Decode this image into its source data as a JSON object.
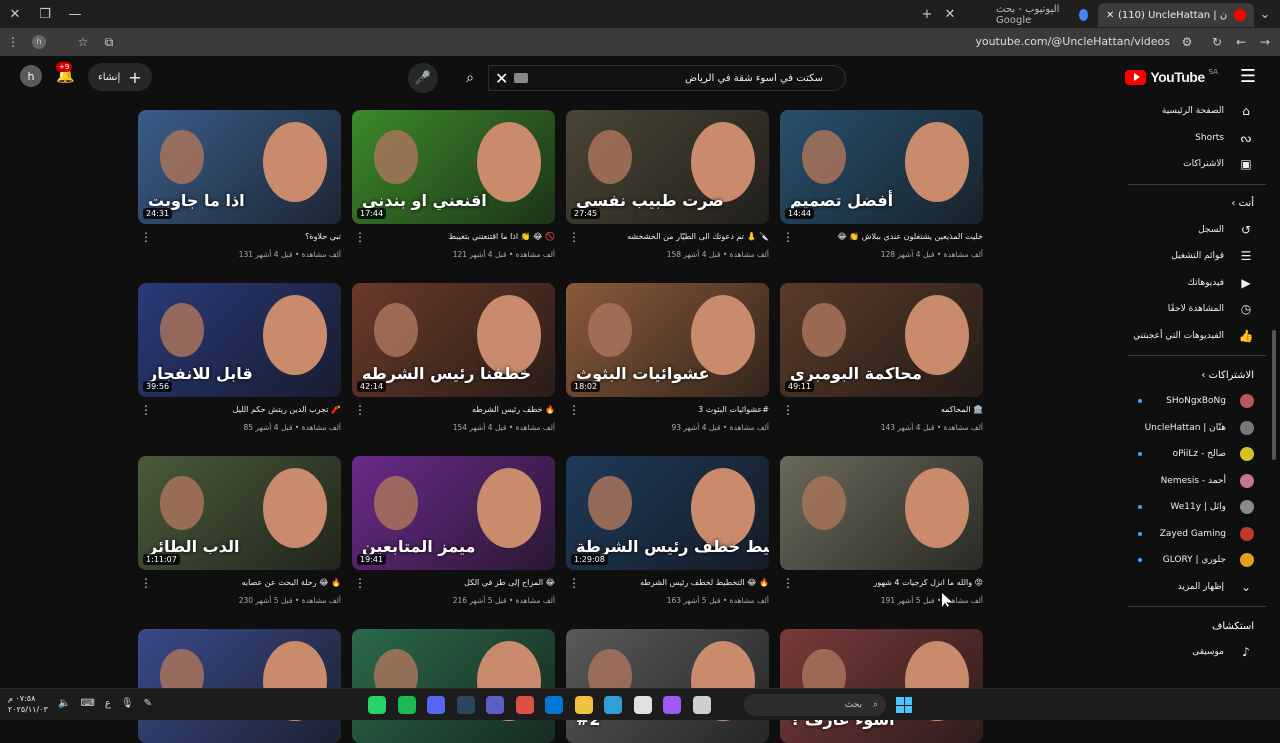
{
  "browser": {
    "tabs": [
      {
        "label": "(110) UncleHattan | هتّان - YouT",
        "active": true
      },
      {
        "label": "اليوتيوب - بحث Google",
        "active": false
      }
    ],
    "url": "youtube.com/@UncleHattan/videos"
  },
  "yt": {
    "logo_text": "YouTube",
    "region": "SA",
    "search_query": "سكتت في اسوء شقة في الرياض",
    "create_label": "إنشاء",
    "notif_count": "+9",
    "avatar_letter": "h"
  },
  "sidebar": {
    "main": [
      {
        "label": "الصفحة الرئيسية",
        "icon": "home-icon",
        "glyph": "⌂"
      },
      {
        "label": "Shorts",
        "icon": "shorts-icon",
        "glyph": "ᔓ"
      },
      {
        "label": "الاشتراكات",
        "icon": "subscriptions-icon",
        "glyph": "▣"
      }
    ],
    "you_header": "أنت",
    "you": [
      {
        "label": "السجل",
        "icon": "history-icon",
        "glyph": "↺"
      },
      {
        "label": "قوائم التشغيل",
        "icon": "playlists-icon",
        "glyph": "☰"
      },
      {
        "label": "فيديوهاتك",
        "icon": "your-videos-icon",
        "glyph": "▶"
      },
      {
        "label": "المشاهدة لاحقًا",
        "icon": "watch-later-icon",
        "glyph": "◷"
      },
      {
        "label": "الفيديوهات التي أعجبتني",
        "icon": "liked-icon",
        "glyph": "👍"
      }
    ],
    "subs_header": "الاشتراكات",
    "subs": [
      {
        "label": "SHoNgxBoNg",
        "color": "#b45a5a",
        "dot": true
      },
      {
        "label": "UncleHattan | هتّان",
        "color": "#777777",
        "dot": false
      },
      {
        "label": "oPiiLz - صالح",
        "color": "#d4c21f",
        "dot": true
      },
      {
        "label": "Nemesis - أحمد",
        "color": "#c0789a",
        "dot": false
      },
      {
        "label": "We11y | وائل",
        "color": "#8a8a8a",
        "dot": true
      },
      {
        "label": "Zayed Gaming",
        "color": "#c0392b",
        "dot": true
      },
      {
        "label": "GLORY | جلوري",
        "color": "#e0a21a",
        "dot": true
      }
    ],
    "show_more": "إظهار المزيد",
    "explore_header": "استكشاف",
    "explore": [
      {
        "label": "موسيقى",
        "icon": "music-icon",
        "glyph": "♪"
      }
    ]
  },
  "videos": [
    {
      "title": "😂 👏 خليت المذيعين يشتغلون عندي ببلاش",
      "views": "128 ألف مشاهدة",
      "age": "قبل 4 أشهر",
      "duration": "14:44",
      "caption": "أفضل تصميم",
      "bg": "#27506d"
    },
    {
      "title": "تم دعوتك الى الطيّار من الخشخشه 👃 🔪",
      "views": "158 ألف مشاهدة",
      "age": "قبل 4 أشهر",
      "duration": "27:45",
      "caption": "صرت طبيب نفسي",
      "bg": "#4a4535"
    },
    {
      "title": "اذا ما اقتنعتني بتغيبط 👏 😂 🚫",
      "views": "121 ألف مشاهدة",
      "age": "قبل 4 أشهر",
      "duration": "17:44",
      "caption": "اقنعني او بندني",
      "bg": "#3c8a2a"
    },
    {
      "title": "تبي حلاوة؟",
      "views": "131 ألف مشاهدة",
      "age": "قبل 4 أشهر",
      "duration": "24:31",
      "caption": "اذا ما جاوبت",
      "bg": "#3a5d8a"
    },
    {
      "title": "المحاكمه 🏛️",
      "views": "143 ألف مشاهدة",
      "age": "قبل 4 أشهر",
      "duration": "49:11",
      "caption": "محاكمة البومبري",
      "bg": "#5a3a2a"
    },
    {
      "title": "عشوائيات البثوث 3#",
      "views": "93 ألف مشاهدة",
      "age": "قبل 4 أشهر",
      "duration": "18:02",
      "caption": "عشوائيات البثوث",
      "bg": "#8a5a3a"
    },
    {
      "title": "خطف رئيس الشرطه 🔥",
      "views": "154 ألف مشاهدة",
      "age": "قبل 4 أشهر",
      "duration": "42:14",
      "caption": "خطفنا رئيس الشرطه",
      "bg": "#6a3a2a"
    },
    {
      "title": "تجرب الدين ريتش حكم الليل 🧨",
      "views": "85 ألف مشاهدة",
      "age": "قبل 4 أشهر",
      "duration": "39:56",
      "caption": "قابل للانفجار",
      "bg": "#2a3a7a"
    },
    {
      "title": "والله ما انزل كرجيات 4 شهور 😡",
      "views": "191 ألف مشاهدة",
      "age": "قبل 5 أشهر",
      "duration": "",
      "caption": "",
      "bg": "#6a6a5a"
    },
    {
      "title": "التخطيط لخطف رئيس الشرطه 😂 🔥",
      "views": "163 ألف مشاهدة",
      "age": "قبل 5 أشهر",
      "duration": "1:29:08",
      "caption": "تخطيط خطف رئيس الشرطة",
      "bg": "#1f3a5a"
    },
    {
      "title": "المزاح إلى طز في الكل 😂",
      "views": "216 ألف مشاهدة",
      "age": "قبل 5 أشهر",
      "duration": "19:41",
      "caption": "ميمز المتابعين",
      "bg": "#6a2a8a"
    },
    {
      "title": "رحلة البحث عن عصابه 😂 🔥",
      "views": "230 ألف مشاهدة",
      "age": "قبل 5 أشهر",
      "duration": "1:11:07",
      "caption": "الدب الطائر",
      "bg": "#4a5a3a"
    },
    {
      "title": "",
      "views": "",
      "age": "",
      "duration": "",
      "caption": "أسوء عارف ؟",
      "bg": "#7a3a3a"
    },
    {
      "title": "",
      "views": "",
      "age": "",
      "duration": "",
      "caption": "#2",
      "bg": "#5a5a5a"
    },
    {
      "title": "",
      "views": "",
      "age": "",
      "duration": "",
      "caption": "",
      "bg": "#2a6a4a"
    },
    {
      "title": "",
      "views": "",
      "age": "",
      "duration": "",
      "caption": "",
      "bg": "#3a4a8a"
    }
  ],
  "taskbar": {
    "search_label": "بحث",
    "time": "٠٧:٥٨ م",
    "date": "٢٠٢٥/١١/٠٣",
    "lang": "ع",
    "apps": [
      {
        "name": "whatsapp-icon",
        "color": "#25d366"
      },
      {
        "name": "spotify-icon",
        "color": "#1db954"
      },
      {
        "name": "discord-icon",
        "color": "#5865f2"
      },
      {
        "name": "steam-icon",
        "color": "#2a475e"
      },
      {
        "name": "teams-icon",
        "color": "#5b5fc7"
      },
      {
        "name": "chrome-icon",
        "color": "#dd5144"
      },
      {
        "name": "outlook-icon",
        "color": "#0078d4"
      },
      {
        "name": "explorer-icon",
        "color": "#f0c040"
      },
      {
        "name": "edge-icon",
        "color": "#2f9fd8"
      },
      {
        "name": "store-icon",
        "color": "#e0e0e0"
      },
      {
        "name": "copilot-icon",
        "color": "#9a5cf0"
      },
      {
        "name": "app-icon",
        "color": "#cfcfcf"
      }
    ]
  }
}
